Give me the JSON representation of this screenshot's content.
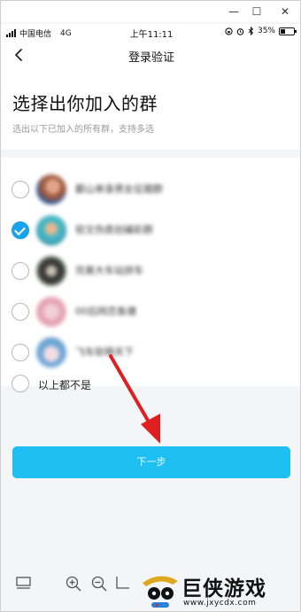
{
  "window": {
    "min_glyph": "—",
    "max_glyph": "☐",
    "close_glyph": "✕"
  },
  "status_bar": {
    "carrier": "中国电信",
    "network": "4G",
    "time": "上午11:11",
    "battery": "35%"
  },
  "nav": {
    "title": "登录验证"
  },
  "header": {
    "title": "选择出你加入的群",
    "subtitle": "选出以下已加入的所有群，支持多选"
  },
  "groups": [
    {
      "name": "鄱山单身男女征婚群",
      "checked": false,
      "avatar_colors": [
        "#a05a40",
        "#3d5a8a"
      ]
    },
    {
      "name": "软文伪类创编彩群",
      "checked": true,
      "avatar_colors": [
        "#45b5c6",
        "#e6b98e"
      ]
    },
    {
      "name": "完美大车站拼车",
      "checked": false,
      "avatar_colors": [
        "#3a3a3a",
        "#c7c0b0"
      ]
    },
    {
      "name": "00后网恋鱼塘",
      "checked": false,
      "avatar_colors": [
        "#e5a5b5",
        "#f3d0da"
      ]
    },
    {
      "name": "飞车软萌天下",
      "checked": false,
      "avatar_colors": [
        "#6fa6d6",
        "#f2dde3"
      ]
    }
  ],
  "none_option": {
    "label": "以上都不是",
    "checked": false
  },
  "next_button": {
    "label": "下一步"
  },
  "bottom_logo": {
    "text": "巨侠游戏",
    "url": "www.jxycdx.com"
  },
  "colors": {
    "accent": "#1aa3ea",
    "button": "#1ec0f2",
    "arrow": "#e02020"
  }
}
